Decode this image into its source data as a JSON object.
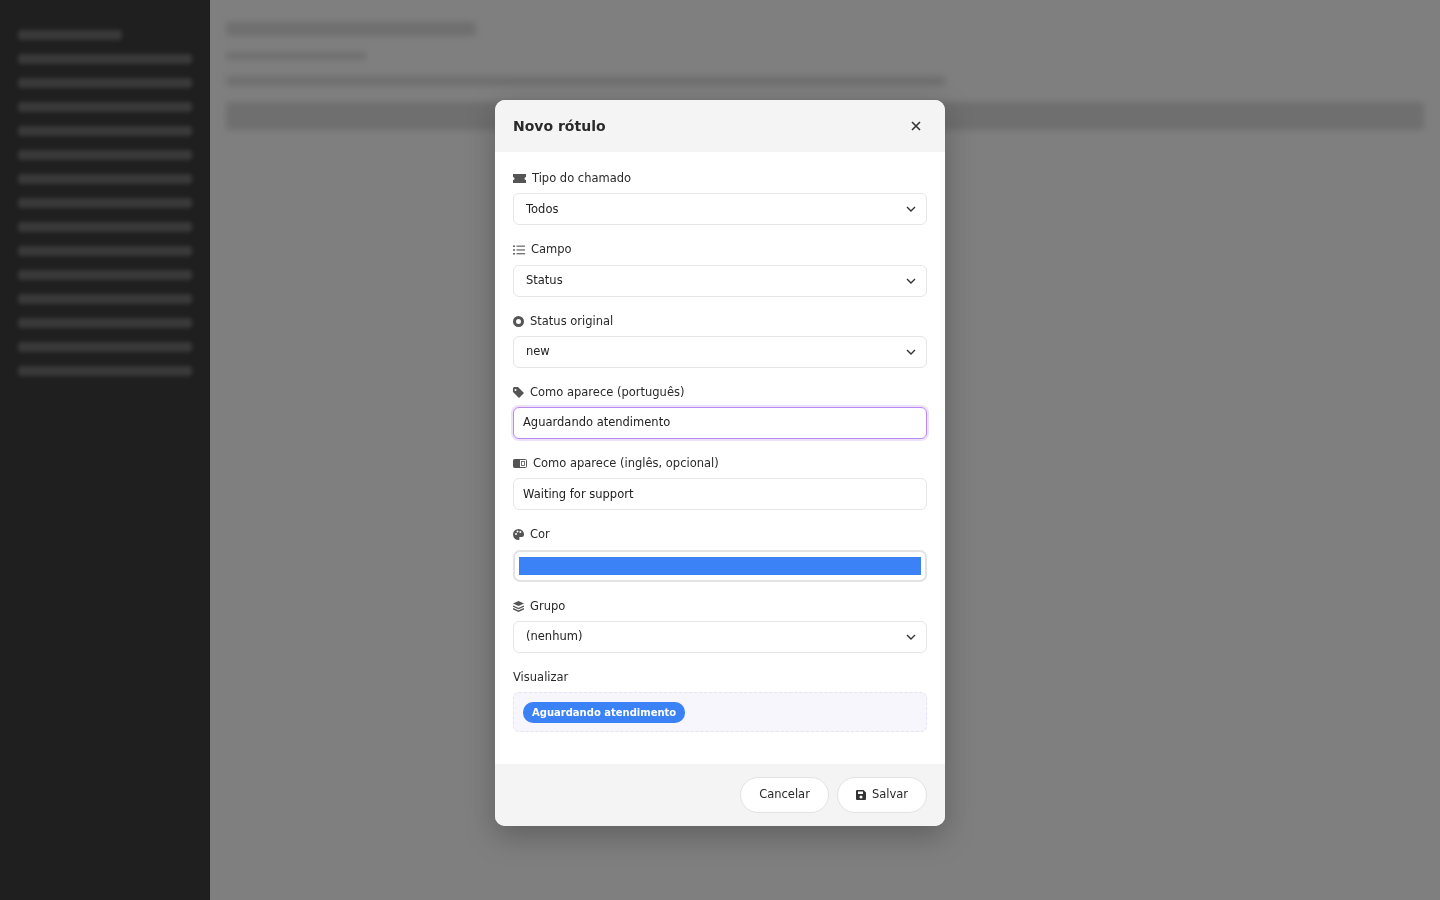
{
  "modal": {
    "title": "Novo rótulo",
    "fields": [
      {
        "kind": "select",
        "label": "Tipo do chamado",
        "value": "Todos",
        "focused": false
      },
      {
        "kind": "select",
        "label": "Campo",
        "value": "Status",
        "focused": false
      },
      {
        "kind": "select",
        "label": "Status original",
        "value": "new",
        "focused": false
      },
      {
        "kind": "text",
        "label": "Como aparece (português)",
        "value": "Aguardando atendimento",
        "focused": true
      },
      {
        "kind": "text",
        "label": "Como aparece (inglês, opcional)",
        "value": "Waiting for support",
        "focused": false
      },
      {
        "kind": "color",
        "label": "Cor",
        "focused": false
      },
      {
        "kind": "select",
        "label": "Grupo",
        "value": "(nenhum)",
        "focused": false
      }
    ],
    "preview": {
      "label": "Visualizar",
      "badge": "Aguardando atendimento",
      "color": "#3b82f6"
    },
    "buttons": [
      {
        "kind": "cancel",
        "label": "Cancelar"
      },
      {
        "kind": "save",
        "label": "Salvar"
      }
    ]
  }
}
